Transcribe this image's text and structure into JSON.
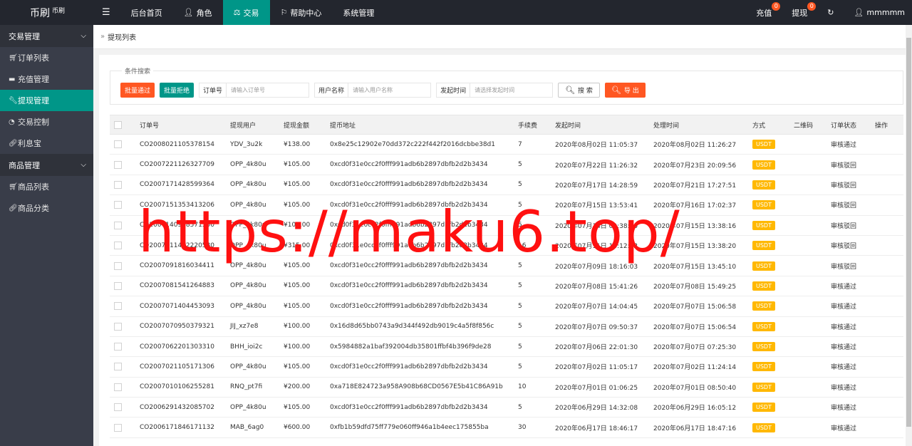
{
  "app": {
    "logo": "币刷",
    "logo_sub": "币刷"
  },
  "topnav": {
    "menu_toggle": "☰",
    "items": [
      {
        "label": "后台首页",
        "icon": ""
      },
      {
        "label": "角色",
        "icon": "user-icon"
      },
      {
        "label": "交易",
        "icon": "scale-icon",
        "active": true
      },
      {
        "label": "帮助中心",
        "icon": "flag-icon"
      },
      {
        "label": "系统管理",
        "icon": ""
      }
    ],
    "recharge_label": "充值",
    "recharge_count": "0",
    "withdraw_label": "提现",
    "withdraw_count": "0",
    "refresh_icon": "refresh-icon",
    "username": "mmmmm"
  },
  "sidebar": {
    "groups": [
      {
        "label": "交易管理",
        "items": [
          {
            "label": "订单列表",
            "icon": "cart-icon"
          },
          {
            "label": "充值管理",
            "icon": "comment-icon"
          },
          {
            "label": "提现管理",
            "icon": "wrench-icon",
            "active": true
          },
          {
            "label": "交易控制",
            "icon": "dashboard-icon"
          },
          {
            "label": "利息宝",
            "icon": "link-icon"
          }
        ]
      },
      {
        "label": "商品管理",
        "items": [
          {
            "label": "商品列表",
            "icon": "cart-icon"
          },
          {
            "label": "商品分类",
            "icon": "link-icon"
          }
        ]
      }
    ]
  },
  "breadcrumb": {
    "title": "提现列表"
  },
  "search": {
    "legend": "条件搜索",
    "batch_approve": "批量通过",
    "batch_reject": "批量拒绝",
    "order_label": "订单号",
    "order_placeholder": "请输入订单号",
    "user_label": "用户名称",
    "user_placeholder": "请输入用户名称",
    "time_label": "发起时间",
    "time_placeholder": "请选择发起时间",
    "search_btn": "搜 索",
    "export_btn": "导 出"
  },
  "table": {
    "headers": [
      "订单号",
      "提现用户",
      "提现金额",
      "提币地址",
      "手续费",
      "发起时间",
      "处理时间",
      "方式",
      "二维码",
      "订单状态",
      "操作"
    ],
    "rows": [
      [
        "CO2008021105378154",
        "YDV_3u2k",
        "¥138.00",
        "0x8e25c12902e70dd372c222f442f2016dcbbe38d1",
        "7",
        "2020年08月02日 11:05:37",
        "2020年08月02日 11:26:27",
        "USDT",
        "",
        "审核通过"
      ],
      [
        "CO2007221126327709",
        "OPP_4k80u",
        "¥105.00",
        "0xcd0f31e0cc2f0fff991adb6b2897dbfb2d2b3434",
        "5",
        "2020年07月22日 11:26:32",
        "2020年07月23日 20:09:56",
        "USDT",
        "",
        "审核驳回"
      ],
      [
        "CO2007171428599364",
        "OPP_4k80u",
        "¥105.00",
        "0xcd0f31e0cc2f0fff991adb6b2897dbfb2d2b3434",
        "5",
        "2020年07月17日 14:28:59",
        "2020年07月21日 17:27:51",
        "USDT",
        "",
        "审核驳回"
      ],
      [
        "CO2007151353413206",
        "OPP_4k80u",
        "¥105.00",
        "0xcd0f31e0cc2f0fff991adb6b2897dbfb2d2b3434",
        "5",
        "2020年07月15日 13:53:41",
        "2020年07月16日 17:02:37",
        "USDT",
        "",
        "审核驳回"
      ],
      [
        "CO2007140938571550",
        "OPP_4k80u",
        "¥105.00",
        "0xcd0f31e0cc2f0fff991adb6b2897dbfb2d2b3434",
        "5",
        "2020年07月14日 09:38:50",
        "2020年07月15日 13:38:16",
        "USDT",
        "",
        "审核驳回"
      ],
      [
        "CO2007111412220580",
        "OPP_4k80u",
        "¥315.00",
        "0xcd0f31e0cc2f0fff991adb6b2897dbfb2d2b3434",
        "16",
        "2020年07月11日 14:12:22",
        "2020年07月15日 13:38:20",
        "USDT",
        "",
        "审核驳回"
      ],
      [
        "CO2007091816034411",
        "OPP_4k80u",
        "¥105.00",
        "0xcd0f31e0cc2f0fff991adb6b2897dbfb2d2b3434",
        "5",
        "2020年07月09日 18:16:03",
        "2020年07月15日 13:45:10",
        "USDT",
        "",
        "审核驳回"
      ],
      [
        "CO2007081541264883",
        "OPP_4k80u",
        "¥105.00",
        "0xcd0f31e0cc2f0fff991adb6b2897dbfb2d2b3434",
        "5",
        "2020年07月08日 15:41:26",
        "2020年07月08日 15:49:25",
        "USDT",
        "",
        "审核通过"
      ],
      [
        "CO2007071404453093",
        "OPP_4k80u",
        "¥105.00",
        "0xcd0f31e0cc2f0fff991adb6b2897dbfb2d2b3434",
        "5",
        "2020年07月07日 14:04:45",
        "2020年07月07日 15:06:58",
        "USDT",
        "",
        "审核通过"
      ],
      [
        "CO2007070950379321",
        "JIJ_xz7e8",
        "¥100.00",
        "0x16d8d65bb0743a9d344f492db9019c4a5f8f856c",
        "5",
        "2020年07月07日 09:50:37",
        "2020年07月07日 15:06:54",
        "USDT",
        "",
        "审核通过"
      ],
      [
        "CO2007062201303310",
        "BHH_ioi2c",
        "¥100.00",
        "0x5984882a1baf392004db35801ffbf4b396f9de28",
        "5",
        "2020年07月06日 22:01:30",
        "2020年07月07日 07:25:30",
        "USDT",
        "",
        "审核通过"
      ],
      [
        "CO2007021105171306",
        "OPP_4k80u",
        "¥105.00",
        "0xcd0f31e0cc2f0fff991adb6b2897dbfb2d2b3434",
        "5",
        "2020年07月02日 11:05:17",
        "2020年07月02日 11:24:14",
        "USDT",
        "",
        "审核通过"
      ],
      [
        "CO2007010106255281",
        "RNQ_pt7fi",
        "¥200.00",
        "0xa718E824723a958A908b68CD0567E5b41C86A91b",
        "10",
        "2020年07月01日 01:06:25",
        "2020年07月01日 08:50:40",
        "USDT",
        "",
        "审核通过"
      ],
      [
        "CO2006291432085702",
        "OPP_4k80u",
        "¥105.00",
        "0xcd0f31e0cc2f0fff991adb6b2897dbfb2d2b3434",
        "5",
        "2020年06月29日 14:32:08",
        "2020年06月29日 16:05:12",
        "USDT",
        "",
        "审核通过"
      ],
      [
        "CO2006171846171132",
        "MAB_6ag0",
        "¥600.00",
        "0xfb1b59dfd75ff779e060ff946a1b4eec175855ba",
        "30",
        "2020年06月17日 18:46:17",
        "2020年06月17日 18:47:16",
        "USDT",
        "",
        "审核通过"
      ]
    ]
  },
  "watermark": "https://maku6.top/"
}
